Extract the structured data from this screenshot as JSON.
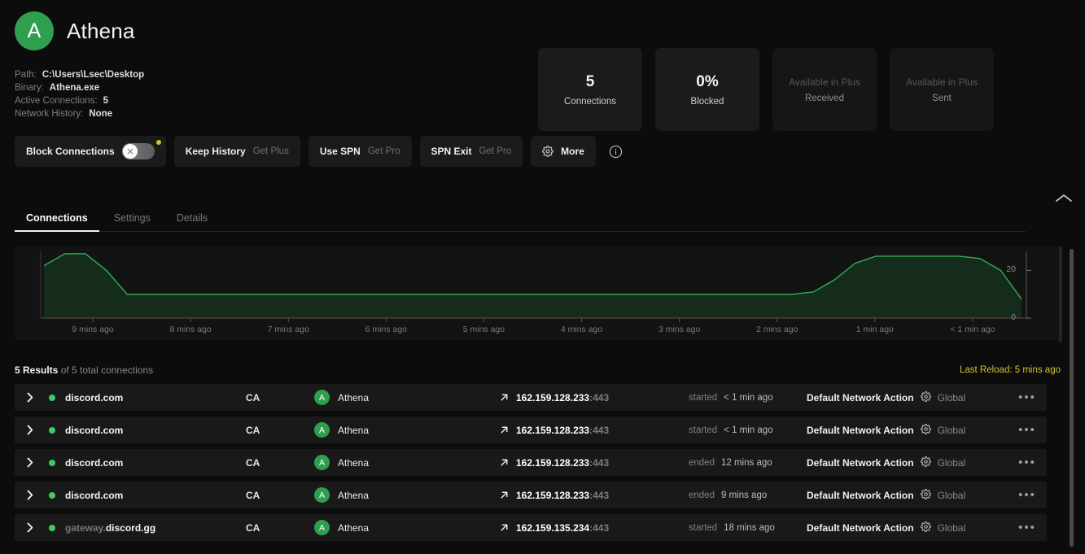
{
  "header": {
    "app_name": "Athena",
    "avatar_initial": "A",
    "meta": [
      {
        "key": "Path:",
        "value": "C:\\Users\\Lsec\\Desktop"
      },
      {
        "key": "Binary:",
        "value": "Athena.exe"
      },
      {
        "key": "Active Connections:",
        "value": "5"
      },
      {
        "key": "Network History:",
        "value": "None"
      }
    ]
  },
  "stats": [
    {
      "value": "5",
      "label": "Connections",
      "muted": false
    },
    {
      "value": "0%",
      "label": "Blocked",
      "muted": false
    },
    {
      "value": "Available in Plus",
      "label": "Received",
      "muted": true
    },
    {
      "value": "Available in Plus",
      "label": "Sent",
      "muted": true
    }
  ],
  "toolbar": {
    "block_connections_label": "Block Connections",
    "keep_history_label": "Keep History",
    "keep_history_sub": "Get Plus",
    "use_spn_label": "Use SPN",
    "use_spn_sub": "Get Pro",
    "spn_exit_label": "SPN Exit",
    "spn_exit_sub": "Get Pro",
    "more_label": "More"
  },
  "tabs": [
    {
      "label": "Connections",
      "active": true
    },
    {
      "label": "Settings",
      "active": false
    },
    {
      "label": "Details",
      "active": false
    }
  ],
  "results": {
    "count_label": "5 Results",
    "total_label": "of 5 total connections",
    "last_reload": "Last Reload: 5 mins ago"
  },
  "chart_data": {
    "type": "area",
    "title": "",
    "xlabel": "",
    "ylabel": "",
    "ylim": [
      0,
      28
    ],
    "yticks": [
      "0",
      "20"
    ],
    "categories": [
      "9 mins ago",
      "8 mins ago",
      "7 mins ago",
      "6 mins ago",
      "5 mins ago",
      "4 mins ago",
      "3 mins ago",
      "2 mins ago",
      "1 min ago",
      "< 1 min ago"
    ],
    "series": [
      {
        "name": "Active Connections",
        "color": "#31b158",
        "values": [
          22,
          27,
          27,
          20,
          10,
          10,
          10,
          10,
          10,
          10,
          10,
          10,
          10,
          10,
          10,
          10,
          10,
          10,
          10,
          10,
          10,
          10,
          10,
          10,
          10,
          10,
          10,
          10,
          10,
          10,
          10,
          10,
          10,
          10,
          10,
          10,
          10,
          11,
          16,
          23,
          26,
          26,
          26,
          26,
          26,
          25,
          20,
          8
        ]
      }
    ]
  },
  "connections": [
    {
      "domain_sub": "",
      "domain_main": "discord.com",
      "country": "CA",
      "process_initial": "A",
      "process": "Athena",
      "ip": "162.159.128.233",
      "port": ":443",
      "state_verb": "started",
      "state_when": "< 1 min ago",
      "action": "Default Network Action",
      "scope": "Global"
    },
    {
      "domain_sub": "",
      "domain_main": "discord.com",
      "country": "CA",
      "process_initial": "A",
      "process": "Athena",
      "ip": "162.159.128.233",
      "port": ":443",
      "state_verb": "started",
      "state_when": "< 1 min ago",
      "action": "Default Network Action",
      "scope": "Global"
    },
    {
      "domain_sub": "",
      "domain_main": "discord.com",
      "country": "CA",
      "process_initial": "A",
      "process": "Athena",
      "ip": "162.159.128.233",
      "port": ":443",
      "state_verb": "ended",
      "state_when": "12 mins ago",
      "action": "Default Network Action",
      "scope": "Global"
    },
    {
      "domain_sub": "",
      "domain_main": "discord.com",
      "country": "CA",
      "process_initial": "A",
      "process": "Athena",
      "ip": "162.159.128.233",
      "port": ":443",
      "state_verb": "ended",
      "state_when": "9 mins ago",
      "action": "Default Network Action",
      "scope": "Global"
    },
    {
      "domain_sub": "gateway.",
      "domain_main": "discord.gg",
      "country": "CA",
      "process_initial": "A",
      "process": "Athena",
      "ip": "162.159.135.234",
      "port": ":443",
      "state_verb": "started",
      "state_when": "18 mins ago",
      "action": "Default Network Action",
      "scope": "Global"
    }
  ],
  "colors": {
    "accent_green": "#2f9e4f",
    "line_green": "#31b158",
    "warning_yellow": "#d4c22c",
    "background": "#0c0c0d"
  },
  "more_menu_glyph": "•••"
}
